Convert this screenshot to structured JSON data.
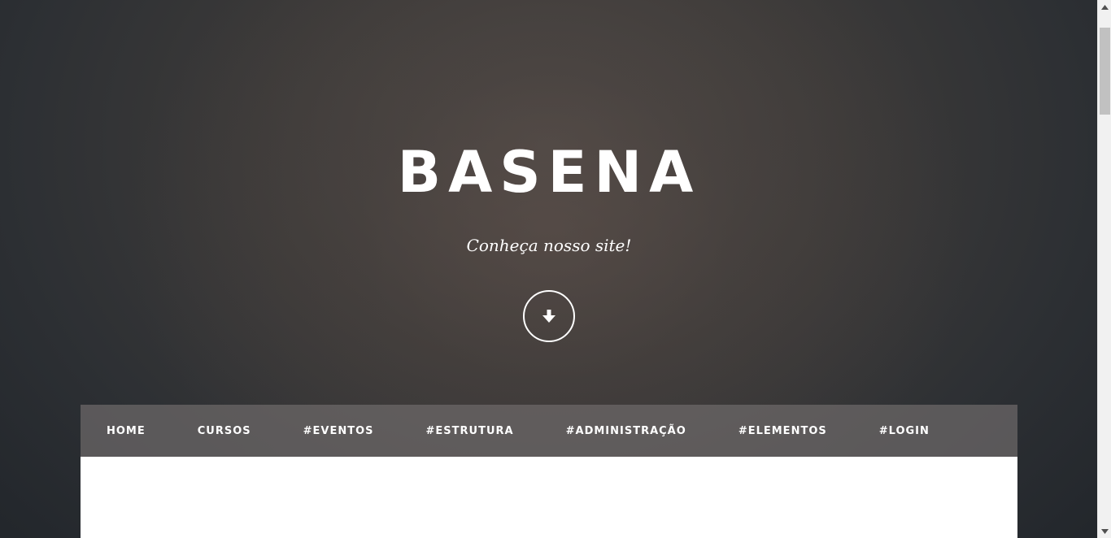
{
  "hero": {
    "title": "BASENA",
    "tagline": "Conheça nosso site!",
    "scroll_icon": "arrow-down-icon"
  },
  "nav": {
    "items": [
      {
        "label": "HOME"
      },
      {
        "label": "CURSOS"
      },
      {
        "label": "#EVENTOS"
      },
      {
        "label": "#ESTRUTURA"
      },
      {
        "label": "#ADMINISTRAÇÃO"
      },
      {
        "label": "#ELEMENTOS"
      },
      {
        "label": "#LOGIN"
      }
    ]
  },
  "colors": {
    "background_dark": "#23272c",
    "hero_center": "#4d4845",
    "navbar": "#6e6a6a",
    "text": "#ffffff",
    "content": "#ffffff"
  },
  "scrollbar": {
    "up_icon": "scroll-up-arrow-icon",
    "down_icon": "scroll-down-arrow-icon"
  }
}
